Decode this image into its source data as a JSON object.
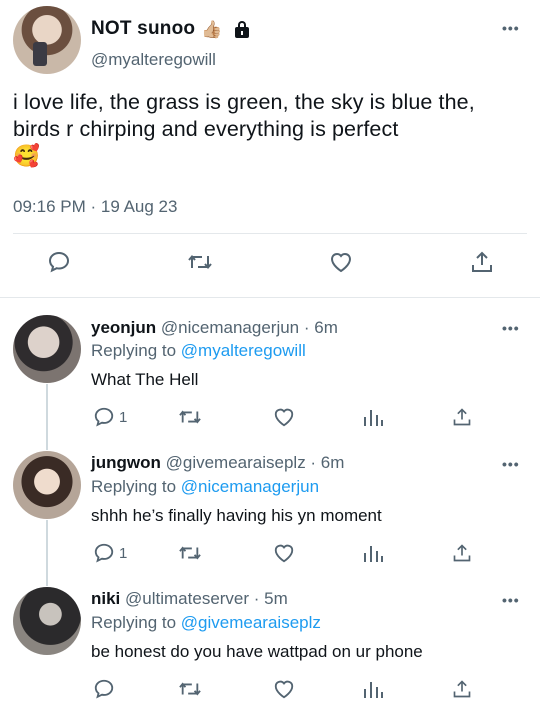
{
  "main_tweet": {
    "display_name": "NOT sunoo",
    "name_emoji": "👍🏼",
    "handle": "@myalteregowill",
    "text": "i love life, the grass is green, the sky is blue the, birds r chirping and everything is perfect",
    "text_emoji": "🥰",
    "timestamp": "09:16 PM · 19 Aug 23",
    "more": "•••"
  },
  "replies": [
    {
      "display_name": "yeonjun",
      "meta": "@nicemanagerjun · 6m",
      "replying_prefix": "Replying to",
      "replying_to": "@myalteregowill",
      "text": "What The Hell",
      "reply_count": "1",
      "more": "•••"
    },
    {
      "display_name": "jungwon",
      "meta": "@givemearaiseplz · 6m",
      "replying_prefix": "Replying to",
      "replying_to": "@nicemanagerjun",
      "text": "shhh he’s finally having his yn moment",
      "reply_count": "1",
      "more": "•••"
    },
    {
      "display_name": "niki",
      "meta": "@ultimateserver · 5m",
      "replying_prefix": "Replying to",
      "replying_to": "@givemearaiseplz",
      "text": "be honest do you have wattpad on ur phone",
      "reply_count": "",
      "more": "•••"
    }
  ],
  "icons": {
    "reply": "speech-bubble-icon",
    "retweet": "retweet-icon",
    "like": "heart-icon",
    "views": "views-bar-icon",
    "share": "share-icon",
    "lock": "lock-icon"
  },
  "colors": {
    "link": "#1d9bf0",
    "secondary_text": "#536471",
    "primary_text": "#0f1419",
    "divider": "#e4e8eb"
  }
}
